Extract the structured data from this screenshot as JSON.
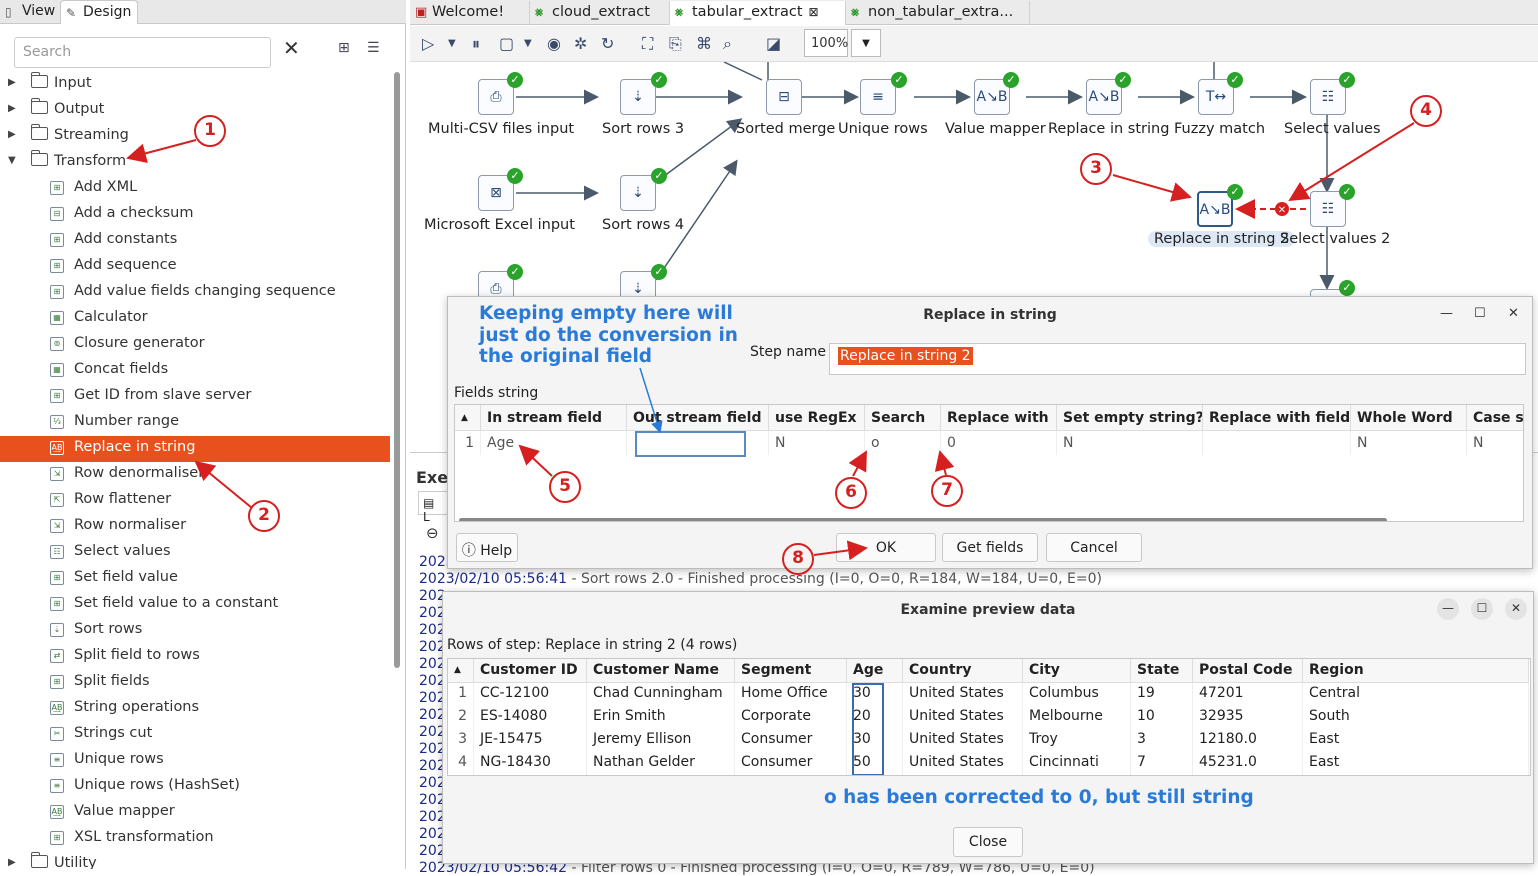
{
  "left_panel": {
    "tabs": [
      {
        "label": "View"
      },
      {
        "label": "Design"
      }
    ],
    "search_placeholder": "Search",
    "tree": [
      {
        "label": "Input",
        "type": "folder"
      },
      {
        "label": "Output",
        "type": "folder"
      },
      {
        "label": "Streaming",
        "type": "folder"
      },
      {
        "label": "Transform",
        "type": "folder",
        "expanded": true
      },
      {
        "label": "Add XML"
      },
      {
        "label": "Add a checksum"
      },
      {
        "label": "Add constants"
      },
      {
        "label": "Add sequence"
      },
      {
        "label": "Add value fields changing sequence"
      },
      {
        "label": "Calculator"
      },
      {
        "label": "Closure generator"
      },
      {
        "label": "Concat fields"
      },
      {
        "label": "Get ID from slave server"
      },
      {
        "label": "Number range"
      },
      {
        "label": "Replace in string",
        "selected": true
      },
      {
        "label": "Row denormaliser"
      },
      {
        "label": "Row flattener"
      },
      {
        "label": "Row normaliser"
      },
      {
        "label": "Select values"
      },
      {
        "label": "Set field value"
      },
      {
        "label": "Set field value to a constant"
      },
      {
        "label": "Sort rows"
      },
      {
        "label": "Split field to rows"
      },
      {
        "label": "Split fields"
      },
      {
        "label": "String operations"
      },
      {
        "label": "Strings cut"
      },
      {
        "label": "Unique rows"
      },
      {
        "label": "Unique rows (HashSet)"
      },
      {
        "label": "Value mapper"
      },
      {
        "label": "XSL transformation"
      },
      {
        "label": "Utility",
        "type": "folder"
      }
    ]
  },
  "editor_tabs": [
    {
      "label": "Welcome!"
    },
    {
      "label": "cloud_extract"
    },
    {
      "label": "tabular_extract",
      "active": true
    },
    {
      "label": "non_tabular_extra..."
    }
  ],
  "toolbar": {
    "zoom": "100%"
  },
  "canvas": {
    "steps": [
      {
        "label": "Multi-CSV files input",
        "icon": "csv-input-icon"
      },
      {
        "label": "Sort rows 3",
        "icon": "sort-icon"
      },
      {
        "label": "Sorted merge",
        "icon": "merge-icon"
      },
      {
        "label": "Unique rows",
        "icon": "unique-icon"
      },
      {
        "label": "Value mapper",
        "icon": "value-mapper-icon"
      },
      {
        "label": "Replace in string",
        "icon": "replace-icon"
      },
      {
        "label": "Fuzzy match",
        "icon": "fuzzy-icon"
      },
      {
        "label": "Select values",
        "icon": "select-values-icon"
      },
      {
        "label": "Microsoft Excel input",
        "icon": "excel-icon"
      },
      {
        "label": "Sort rows 4",
        "icon": "sort-icon"
      },
      {
        "label": "Replace in string 2",
        "icon": "replace-icon"
      },
      {
        "label": "Select values 2",
        "icon": "select-values-icon"
      }
    ]
  },
  "execution": {
    "label": "Exec",
    "log": [
      {
        "ts": "2023",
        "rest": ""
      },
      {
        "ts": "2023/02/10 05:56:41",
        "rest": " - Sort rows 2.0 - Finished processing (I=0, O=0, R=184, W=184, U=0, E=0)"
      },
      {
        "ts": "202",
        "rest": ""
      },
      {
        "ts": "202",
        "rest": ""
      },
      {
        "ts": "202",
        "rest": ""
      },
      {
        "ts": "202",
        "rest": ""
      },
      {
        "ts": "202",
        "rest": ""
      },
      {
        "ts": "202",
        "rest": ""
      },
      {
        "ts": "202",
        "rest": ""
      },
      {
        "ts": "202",
        "rest": ""
      },
      {
        "ts": "202",
        "rest": ""
      },
      {
        "ts": "202",
        "rest": ""
      },
      {
        "ts": "202",
        "rest": ""
      },
      {
        "ts": "202",
        "rest": ""
      },
      {
        "ts": "202",
        "rest": ""
      },
      {
        "ts": "202",
        "rest": ""
      },
      {
        "ts": "202",
        "rest": ""
      },
      {
        "ts": "202",
        "rest": ""
      },
      {
        "ts": "2023/02/10 05:56:42",
        "rest": " - Filter rows 0 - Finished processing (I=0, O=0, R=789, W=786, U=0, E=0)"
      }
    ]
  },
  "replace_dialog": {
    "title": "Replace in string",
    "step_name_label": "Step name",
    "step_name_value": "Replace in string 2",
    "fields_label": "Fields string",
    "columns": [
      "In stream field",
      "Out stream field",
      "use RegEx",
      "Search",
      "Replace with",
      "Set empty string?",
      "Replace with field",
      "Whole Word",
      "Case sen"
    ],
    "rows": [
      {
        "num": "1",
        "cells": [
          "Age",
          "",
          "N",
          "o",
          "0",
          "N",
          "",
          "N",
          "N"
        ]
      }
    ],
    "buttons": {
      "help": "Help",
      "ok": "OK",
      "get_fields": "Get fields",
      "cancel": "Cancel"
    }
  },
  "preview_dialog": {
    "title": "Examine preview data",
    "rows_label": "Rows of step: Replace in string 2 (4 rows)",
    "columns": [
      "Customer ID",
      "Customer Name",
      "Segment",
      "Age",
      "Country",
      "City",
      "State",
      "Postal Code",
      "Region"
    ],
    "rows": [
      {
        "num": "1",
        "cells": [
          "CC-12100",
          "Chad Cunningham",
          "Home Office",
          "30",
          "United States",
          "Columbus",
          "19",
          "47201",
          "Central"
        ]
      },
      {
        "num": "2",
        "cells": [
          "ES-14080",
          "Erin Smith",
          "Corporate",
          "20",
          "United States",
          "Melbourne",
          "10",
          "32935",
          "South"
        ]
      },
      {
        "num": "3",
        "cells": [
          "JE-15475",
          "Jeremy Ellison",
          "Consumer",
          "30",
          "United States",
          "Troy",
          "3",
          "12180.0",
          "East"
        ]
      },
      {
        "num": "4",
        "cells": [
          "NG-18430",
          "Nathan Gelder",
          "Consumer",
          "50",
          "United States",
          "Cincinnati",
          "7",
          "45231.0",
          "East"
        ]
      }
    ],
    "close": "Close"
  },
  "annotations": {
    "badges": [
      "1",
      "2",
      "3",
      "4",
      "5",
      "6",
      "7",
      "8"
    ],
    "note_empty": "Keeping empty here will just do the conversion in the original field",
    "note_corrected": "o has been corrected to 0, but still string",
    "color": "#d62020",
    "note_color": "#2a7ad8"
  }
}
